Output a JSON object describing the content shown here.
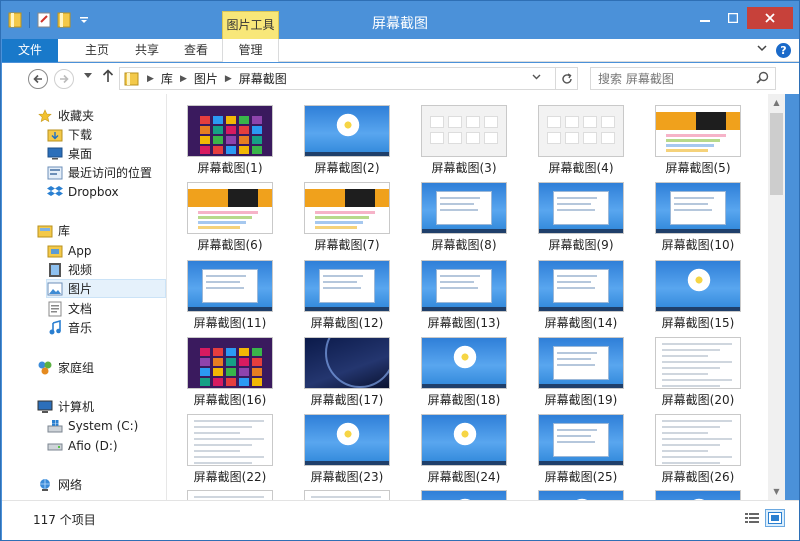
{
  "window": {
    "title": "屏幕截图",
    "contextual_tab_group": "图片工具",
    "accent": "#4b91d9",
    "close_color": "#c7413a"
  },
  "ribbon": {
    "tabs": [
      "文件",
      "主页",
      "共享",
      "查看",
      "管理"
    ],
    "help": "?"
  },
  "nav": {
    "breadcrumbs": [
      "库",
      "图片",
      "屏幕截图"
    ],
    "search_placeholder": "搜索 屏幕截图"
  },
  "sidebar": {
    "favorites_header": "收藏夹",
    "favorites": [
      "下载",
      "桌面",
      "最近访问的位置",
      "Dropbox"
    ],
    "libraries_header": "库",
    "libraries": [
      "App",
      "视频",
      "图片",
      "文档",
      "音乐"
    ],
    "selected_library": "图片",
    "homegroup": "家庭组",
    "computer_header": "计算机",
    "drives": [
      "System (C:)",
      "Afio (D:)"
    ],
    "network": "网络"
  },
  "files": [
    {
      "name": "屏幕截图(1)",
      "thumb": "metro"
    },
    {
      "name": "屏幕截图(2)",
      "thumb": "desktop"
    },
    {
      "name": "屏幕截图(3)",
      "thumb": "gray"
    },
    {
      "name": "屏幕截图(4)",
      "thumb": "gray"
    },
    {
      "name": "屏幕截图(5)",
      "thumb": "web"
    },
    {
      "name": "屏幕截图(6)",
      "thumb": "web"
    },
    {
      "name": "屏幕截图(7)",
      "thumb": "web"
    },
    {
      "name": "屏幕截图(8)",
      "thumb": "desktop-window"
    },
    {
      "name": "屏幕截图(9)",
      "thumb": "desktop-window"
    },
    {
      "name": "屏幕截图(10)",
      "thumb": "desktop-window"
    },
    {
      "name": "屏幕截图(11)",
      "thumb": "desktop-window"
    },
    {
      "name": "屏幕截图(12)",
      "thumb": "desktop-window"
    },
    {
      "name": "屏幕截图(13)",
      "thumb": "desktop-window"
    },
    {
      "name": "屏幕截图(14)",
      "thumb": "desktop-window"
    },
    {
      "name": "屏幕截图(15)",
      "thumb": "desktop"
    },
    {
      "name": "屏幕截图(16)",
      "thumb": "metro"
    },
    {
      "name": "屏幕截图(17)",
      "thumb": "night"
    },
    {
      "name": "屏幕截图(18)",
      "thumb": "desktop"
    },
    {
      "name": "屏幕截图(19)",
      "thumb": "desktop-window"
    },
    {
      "name": "屏幕截图(20)",
      "thumb": "doc"
    },
    {
      "name": "屏幕截图(22)",
      "thumb": "doc"
    },
    {
      "name": "屏幕截图(23)",
      "thumb": "desktop"
    },
    {
      "name": "屏幕截图(24)",
      "thumb": "desktop"
    },
    {
      "name": "屏幕截图(25)",
      "thumb": "desktop-window"
    },
    {
      "name": "屏幕截图(26)",
      "thumb": "doc"
    },
    {
      "name": "",
      "thumb": "doc"
    },
    {
      "name": "",
      "thumb": "doc"
    },
    {
      "name": "",
      "thumb": "desktop"
    },
    {
      "name": "",
      "thumb": "desktop"
    },
    {
      "name": "",
      "thumb": "desktop"
    }
  ],
  "status": {
    "item_count": "117 个项目"
  }
}
